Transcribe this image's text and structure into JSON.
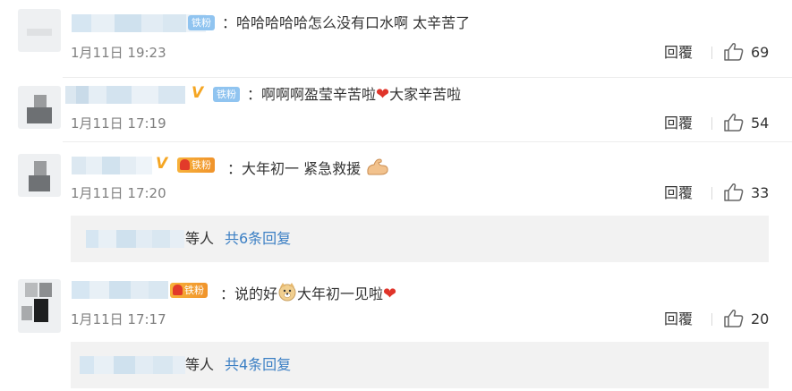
{
  "comments": [
    {
      "fan_badge": "铁粉",
      "text": "：哈哈哈哈哈怎么没有口水啊 太辛苦了",
      "time": "1月11日 19:23",
      "reply_label": "回覆",
      "likes": "69"
    },
    {
      "fan_badge": "铁粉",
      "text_before": "：啊啊啊盈莹辛苦啦",
      "text_after": "大家辛苦啦",
      "time": "1月11日 17:19",
      "reply_label": "回覆",
      "likes": "54"
    },
    {
      "fan_badge": "铁粉",
      "text": "：大年初一 紧急救援",
      "time": "1月11日 17:20",
      "reply_label": "回覆",
      "likes": "33",
      "replies": {
        "people": "等人",
        "more": "共6条回复"
      }
    },
    {
      "fan_badge": "铁粉",
      "text_before": "：说的好",
      "text_after": "大年初一见啦",
      "time": "1月11日 17:17",
      "reply_label": "回覆",
      "likes": "20",
      "replies": {
        "people": "等人",
        "more": "共4条回复"
      }
    }
  ],
  "colors": {
    "link": "#3b7fc4",
    "badge_blue": "#90c4f0",
    "badge_gold": "#f0932b",
    "heart": "#e0342a",
    "verified": "#f5a623"
  },
  "icons": [
    "like-icon",
    "heart-emoji",
    "flexed-biceps-emoji",
    "doge-emoji",
    "verified-v-icon"
  ]
}
